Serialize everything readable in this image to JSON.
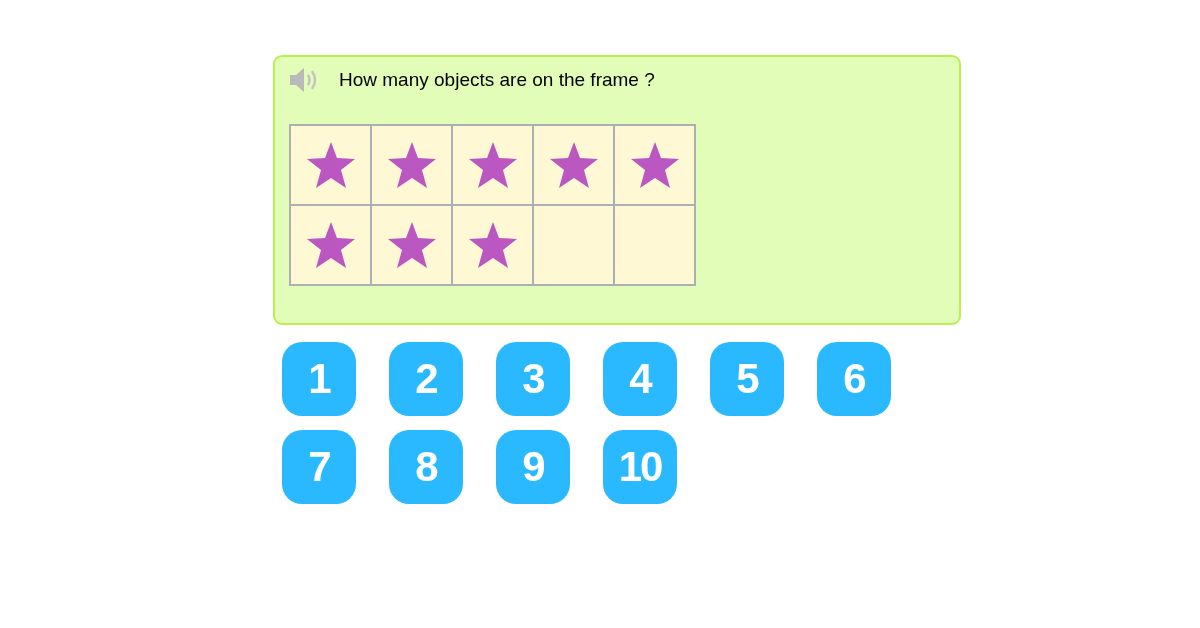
{
  "question": "How many objects are on the frame ?",
  "frame": {
    "cells": [
      {
        "filled": true
      },
      {
        "filled": true
      },
      {
        "filled": true
      },
      {
        "filled": true
      },
      {
        "filled": true
      },
      {
        "filled": true
      },
      {
        "filled": true
      },
      {
        "filled": true
      },
      {
        "filled": false
      },
      {
        "filled": false
      }
    ]
  },
  "answers": [
    "1",
    "2",
    "3",
    "4",
    "5",
    "6",
    "7",
    "8",
    "9",
    "10"
  ]
}
